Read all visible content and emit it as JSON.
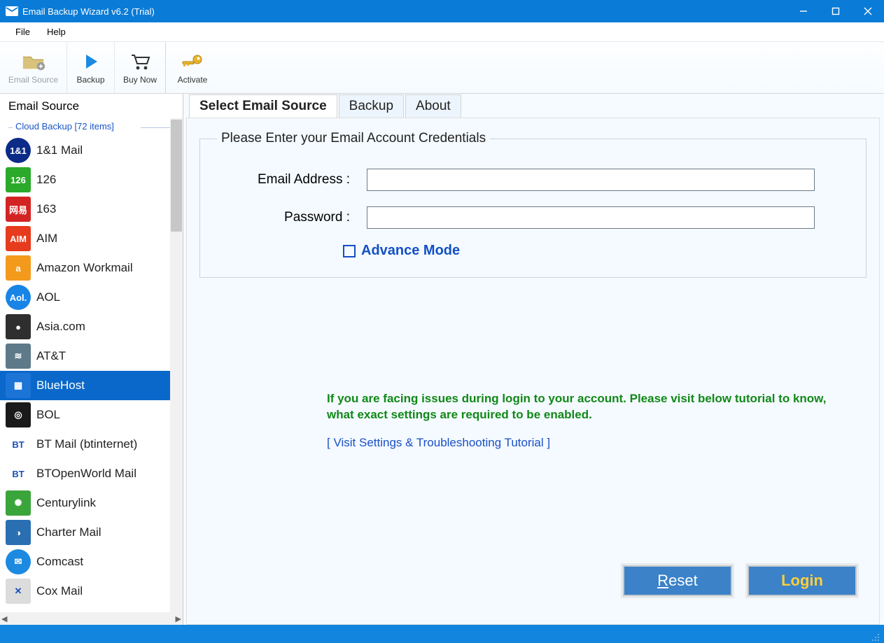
{
  "window": {
    "title": "Email Backup Wizard v6.2 (Trial)"
  },
  "menu": {
    "file": "File",
    "help": "Help"
  },
  "toolbar": {
    "email_source": "Email Source",
    "backup": "Backup",
    "buy_now": "Buy Now",
    "activate": "Activate"
  },
  "sidebar": {
    "title": "Email Source",
    "cloud_header": "Cloud Backup [72 items]",
    "selected_index": 8,
    "items": [
      {
        "label": "1&1 Mail",
        "icon": "1&1",
        "bg": "#0b2b87"
      },
      {
        "label": "126",
        "icon": "126",
        "bg": "#2aa92a"
      },
      {
        "label": "163",
        "icon": "网易",
        "bg": "#d32424"
      },
      {
        "label": "AIM",
        "icon": "AIM",
        "bg": "#e63b1c"
      },
      {
        "label": "Amazon Workmail",
        "icon": "a",
        "bg": "#f39a1d"
      },
      {
        "label": "AOL",
        "icon": "Aol.",
        "bg": "#1884e6"
      },
      {
        "label": "Asia.com",
        "icon": "●",
        "bg": "#2f2f2f"
      },
      {
        "label": "AT&T",
        "icon": "≋",
        "bg": "#5e7a8a"
      },
      {
        "label": "BlueHost",
        "icon": "▦",
        "bg": "#1b74d6"
      },
      {
        "label": "BOL",
        "icon": "◎",
        "bg": "#1a1a1a"
      },
      {
        "label": "BT Mail (btinternet)",
        "icon": "BT",
        "bg": "#ffffff"
      },
      {
        "label": "BTOpenWorld Mail",
        "icon": "BT",
        "bg": "#ffffff"
      },
      {
        "label": "Centurylink",
        "icon": "✺",
        "bg": "#3aa53a"
      },
      {
        "label": "Charter Mail",
        "icon": "◑",
        "bg": "#2a6fb2"
      },
      {
        "label": "Comcast",
        "icon": "✉",
        "bg": "#1b8ae0"
      },
      {
        "label": "Cox Mail",
        "icon": "✕",
        "bg": "#dcdcdc"
      }
    ]
  },
  "tabs": {
    "select": "Select Email Source",
    "backup": "Backup",
    "about": "About"
  },
  "form": {
    "legend": "Please Enter your Email Account Credentials",
    "email_label": "Email Address :",
    "password_label": "Password :",
    "email_value": "",
    "password_value": "",
    "advance_mode": "Advance Mode"
  },
  "help": {
    "text": "If you are facing issues during login to your account. Please visit below tutorial to know, what exact settings are required to be enabled.",
    "link": "[ Visit Settings & Troubleshooting Tutorial ]"
  },
  "buttons": {
    "reset_pre": "R",
    "reset_post": "eset",
    "login": "Login"
  }
}
